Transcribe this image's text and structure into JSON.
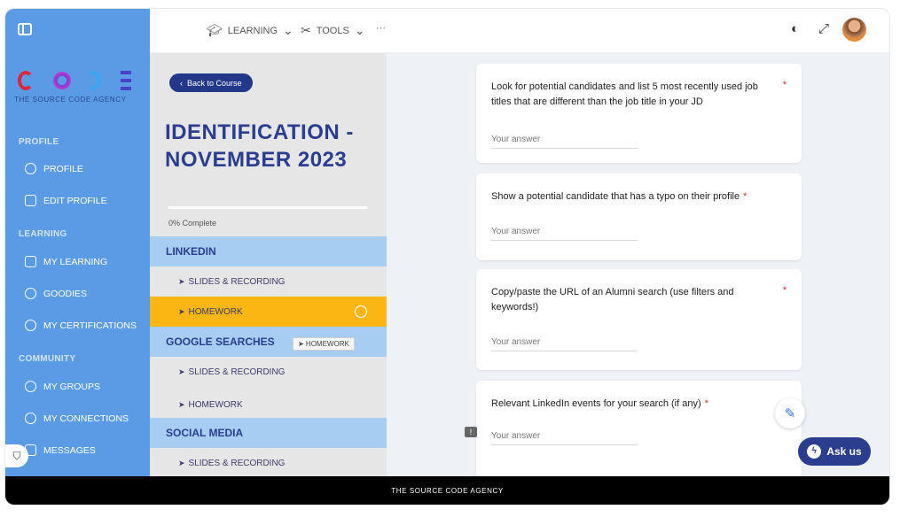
{
  "topbar": {
    "learning_label": "LEARNING",
    "tools_label": "TOOLS",
    "more_label": "···"
  },
  "logo": {
    "text": "THE SOURCE CODE AGENCY"
  },
  "sidebar": {
    "profile_section": "PROFILE",
    "learning_section": "LEARNING",
    "community_section": "COMMUNITY",
    "items": [
      {
        "label": "PROFILE",
        "icon": "user-icon"
      },
      {
        "label": "EDIT PROFILE",
        "icon": "pencil-icon"
      },
      {
        "label": "MY LEARNING",
        "icon": "book-icon"
      },
      {
        "label": "GOODIES",
        "icon": "gift-icon"
      },
      {
        "label": "MY CERTIFICATIONS",
        "icon": "certificate-icon"
      },
      {
        "label": "MY GROUPS",
        "icon": "group-icon"
      },
      {
        "label": "MY CONNECTIONS",
        "icon": "connections-icon"
      },
      {
        "label": "MESSAGES",
        "icon": "message-icon"
      }
    ]
  },
  "course": {
    "back_label": "Back to Course",
    "title": "IDENTIFICATION - NOVEMBER 2023",
    "progress_percent": 0,
    "progress_label": "0% Complete",
    "sections": [
      {
        "title": "LINKEDIN",
        "lessons": [
          "SLIDES & RECORDING",
          "HOMEWORK"
        ]
      },
      {
        "title": "GOOGLE SEARCHES",
        "lessons": [
          "SLIDES & RECORDING",
          "HOMEWORK"
        ]
      },
      {
        "title": "SOCIAL MEDIA",
        "lessons": [
          "SLIDES & RECORDING"
        ]
      }
    ],
    "tooltip": "➤ HOMEWORK"
  },
  "questions": [
    {
      "text": "Look for potential candidates and list 5 most recently used job titles that are different than the job title in your JD",
      "required": "*",
      "placeholder": "Your answer"
    },
    {
      "text": "Show a potential candidate that has a typo on their profile",
      "required": "*",
      "placeholder": "Your answer"
    },
    {
      "text": "Copy/paste the URL of an Alumni search (use filters and keywords!)",
      "required": "*",
      "placeholder": "Your answer"
    },
    {
      "text": "Relevant LinkedIn events for your search (if any)",
      "required": "*",
      "placeholder": "Your answer"
    }
  ],
  "ask_label": "Ask us",
  "footer": "THE SOURCE CODE AGENCY"
}
